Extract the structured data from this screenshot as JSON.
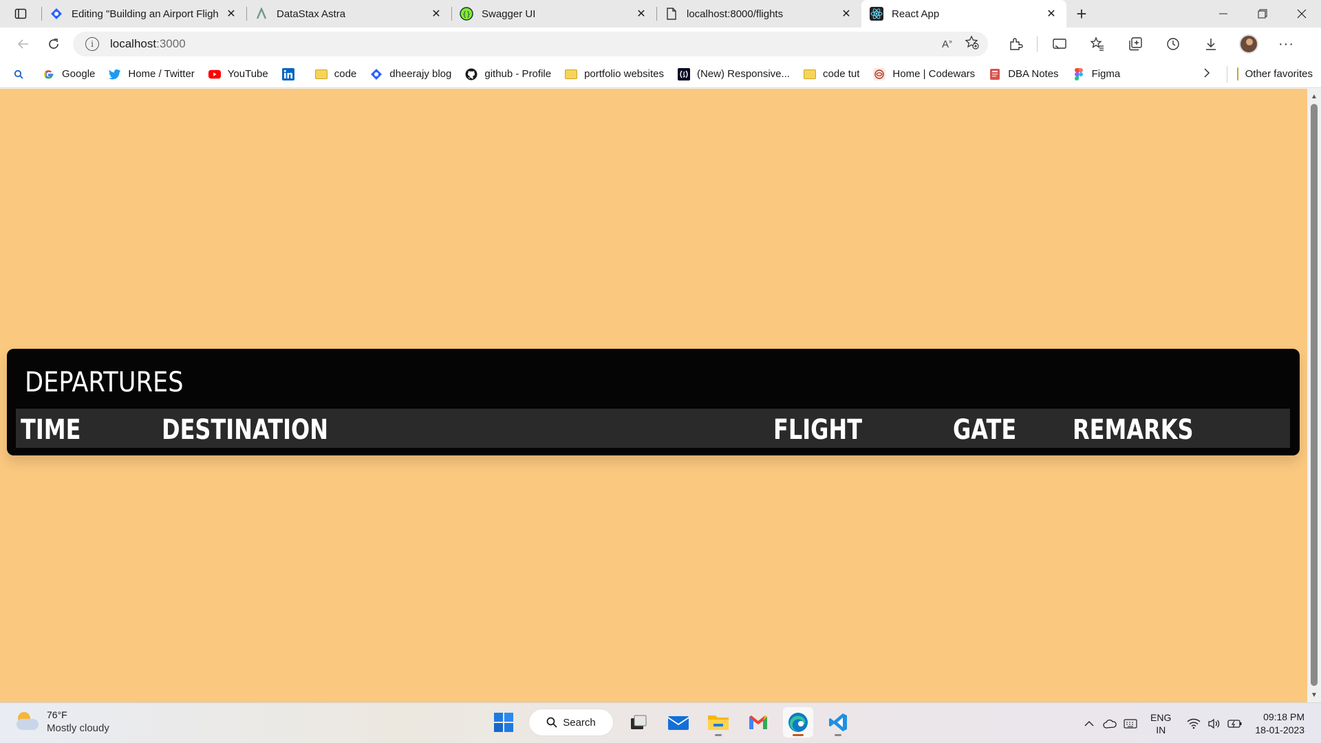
{
  "tabs": [
    {
      "title": "Editing \"Building an Airport Fligh",
      "icon": "hashnode-icon",
      "active": false
    },
    {
      "title": "DataStax Astra",
      "icon": "astra-icon",
      "active": false
    },
    {
      "title": "Swagger UI",
      "icon": "swagger-icon",
      "active": false
    },
    {
      "title": "localhost:8000/flights",
      "icon": "page-icon",
      "active": false
    },
    {
      "title": "React App",
      "icon": "react-icon",
      "active": true
    }
  ],
  "address": {
    "host": "localhost",
    "port": ":3000"
  },
  "favorites": [
    {
      "label": "",
      "icon": "search-icon"
    },
    {
      "label": "Google",
      "icon": "google-icon"
    },
    {
      "label": "Home / Twitter",
      "icon": "twitter-icon"
    },
    {
      "label": "YouTube",
      "icon": "youtube-icon"
    },
    {
      "label": "",
      "icon": "linkedin-icon"
    },
    {
      "label": "code",
      "icon": "folder-icon"
    },
    {
      "label": "dheerajy blog",
      "icon": "hashnode-icon"
    },
    {
      "label": "github - Profile",
      "icon": "github-icon"
    },
    {
      "label": "portfolio websites",
      "icon": "folder-icon"
    },
    {
      "label": "(New) Responsive...",
      "icon": "freecodecamp-icon"
    },
    {
      "label": "code tut",
      "icon": "folder-icon"
    },
    {
      "label": "Home | Codewars",
      "icon": "codewars-icon"
    },
    {
      "label": "DBA Notes",
      "icon": "notes-icon"
    },
    {
      "label": "Figma",
      "icon": "figma-icon"
    }
  ],
  "other_favorites": "Other favorites",
  "board": {
    "title": "DEPARTURES",
    "columns": [
      "TIME",
      "DESTINATION",
      "FLIGHT",
      "GATE",
      "REMARKS"
    ]
  },
  "taskbar": {
    "weather_temp": "76°F",
    "weather_desc": "Mostly cloudy",
    "search_label": "Search",
    "lang_line1": "ENG",
    "lang_line2": "IN",
    "time": "09:18 PM",
    "date": "18-01-2023"
  },
  "colors": {
    "page_bg": "#fac87f",
    "board_bg": "#050505",
    "header_row_bg": "#2a2a2a"
  }
}
